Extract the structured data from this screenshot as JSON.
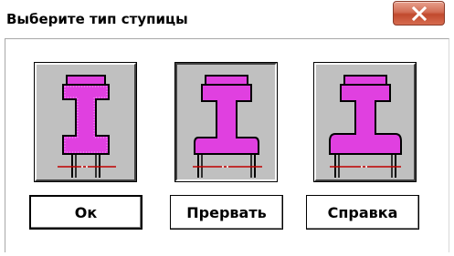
{
  "dialog": {
    "title": "Выберите тип ступицы",
    "close_icon": "close-x-icon"
  },
  "hub_options": [
    {
      "name": "hub-type-1",
      "icon": "hub-symmetric-icon",
      "selected": false
    },
    {
      "name": "hub-type-2",
      "icon": "hub-asymmetric-icon",
      "selected": true
    },
    {
      "name": "hub-type-3",
      "icon": "hub-flanged-icon",
      "selected": false
    }
  ],
  "buttons": {
    "ok": "Ок",
    "cancel": "Прервать",
    "help": "Справка"
  },
  "colors": {
    "hub_fill": "#e040e0",
    "axis_line": "#c00000",
    "close_button": "#c14a2e"
  }
}
